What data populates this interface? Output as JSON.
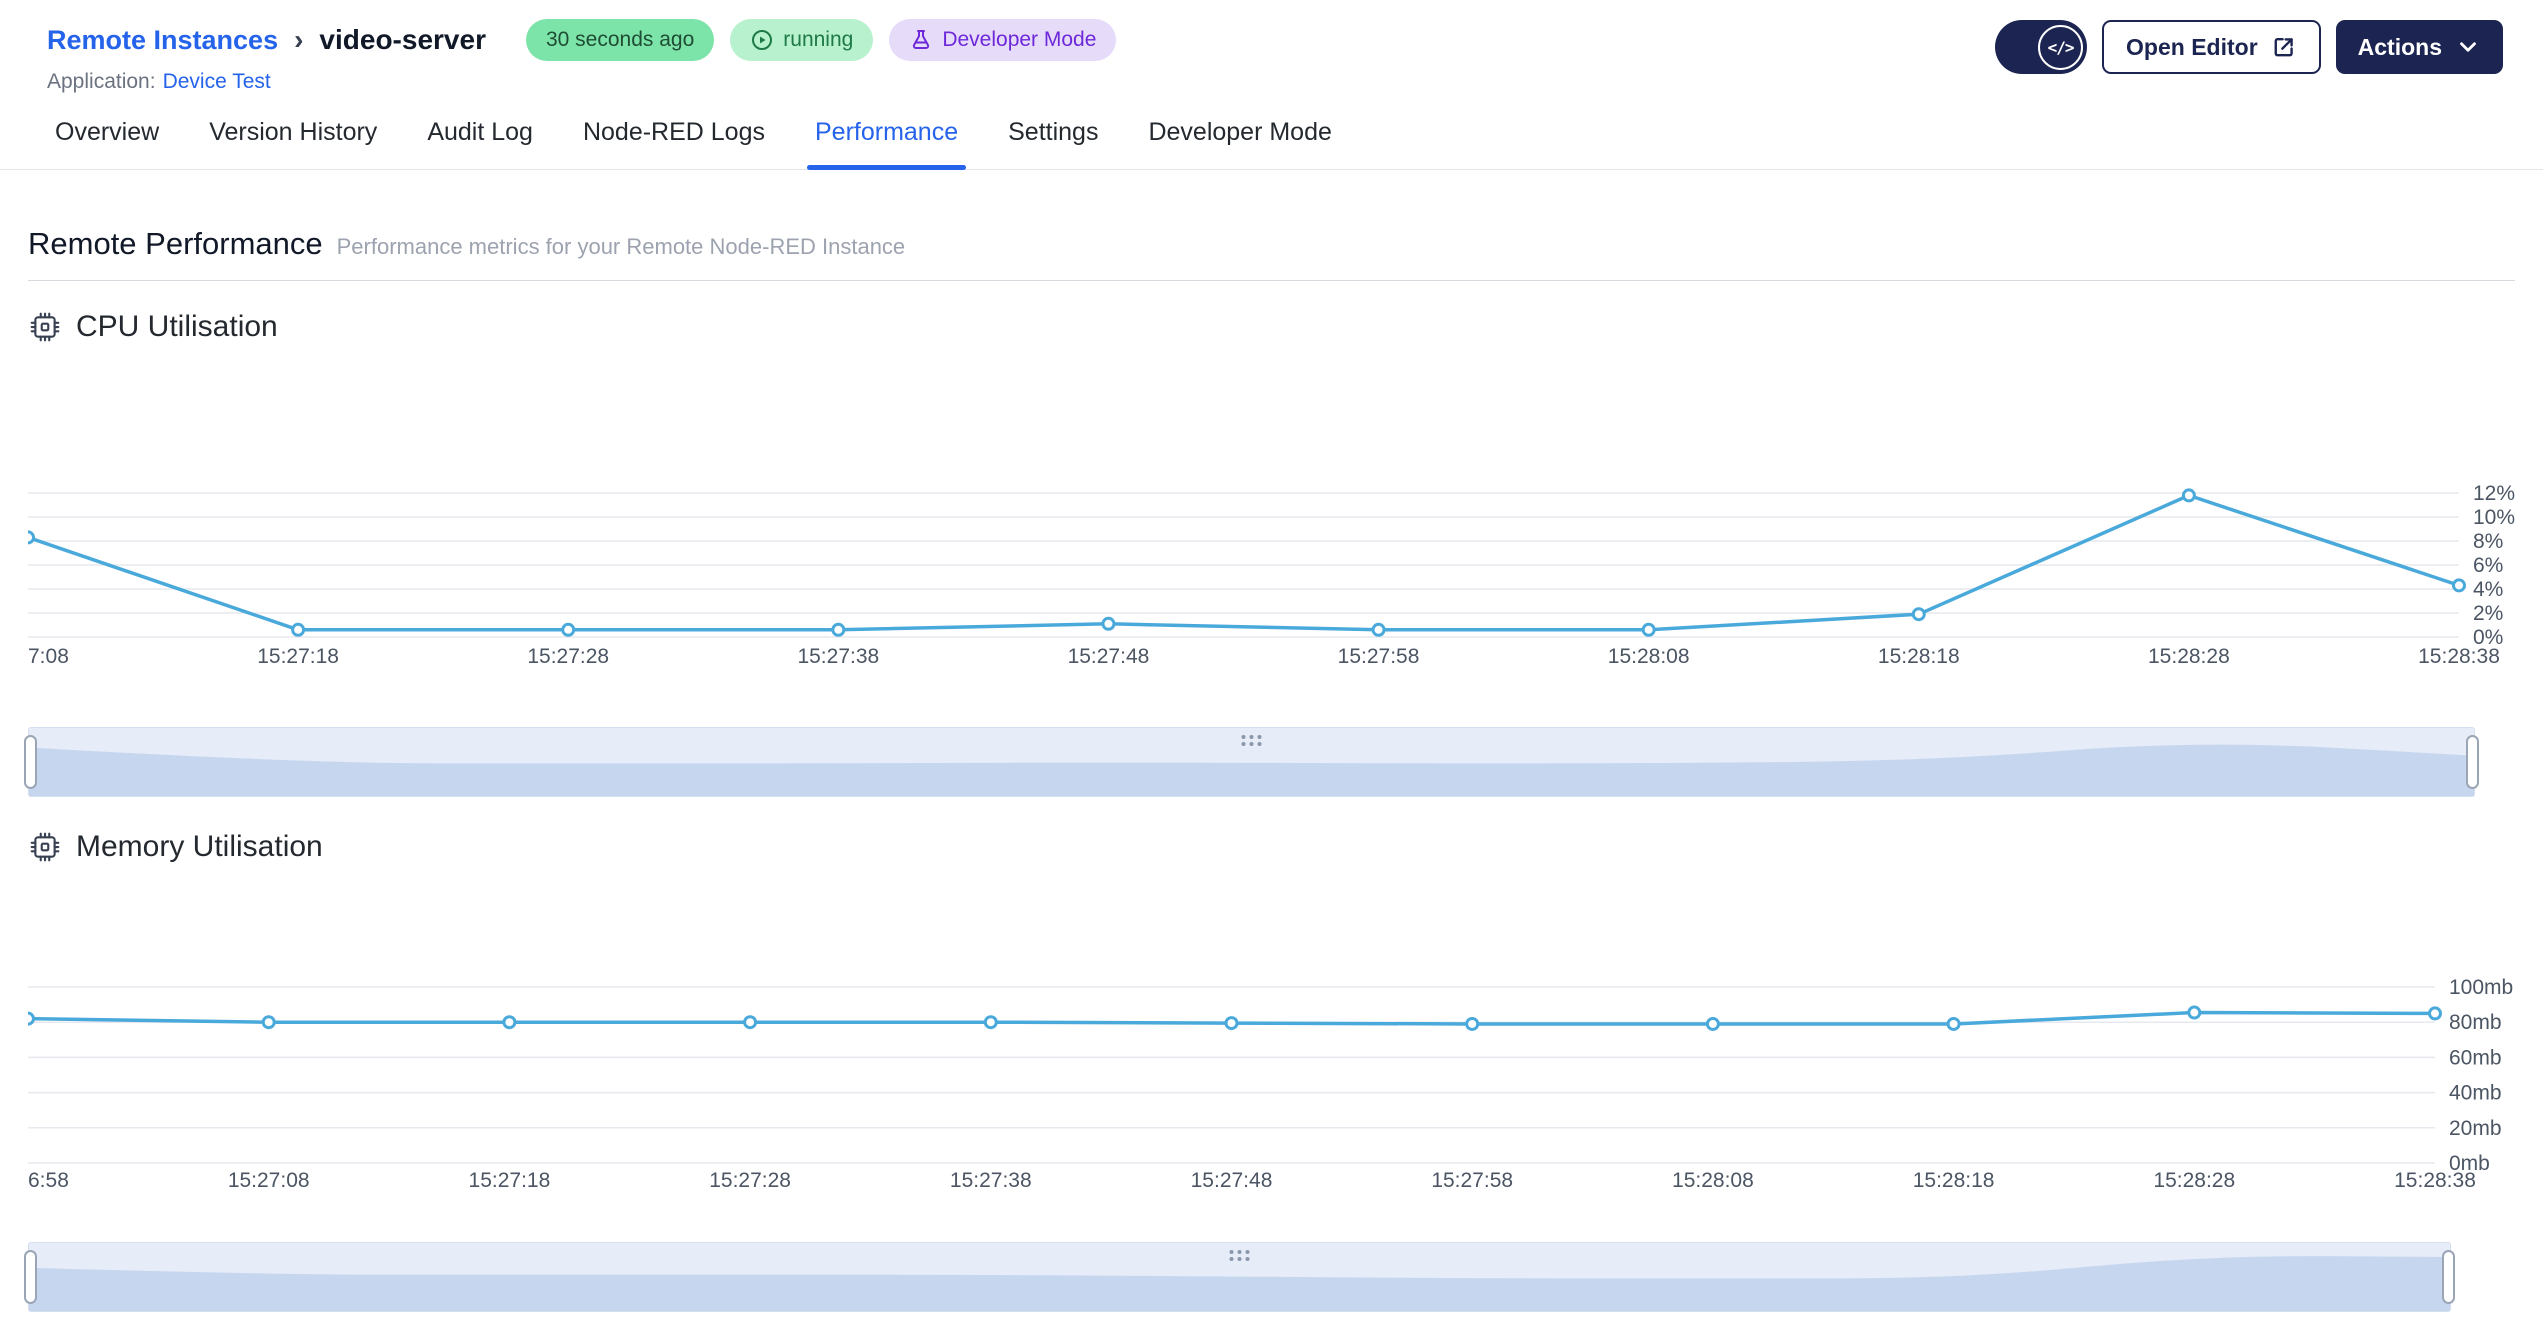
{
  "header": {
    "breadcrumb": {
      "root": "Remote Instances",
      "separator": "›",
      "current": "video-server"
    },
    "badges": {
      "last_seen": "30 seconds ago",
      "status": "running",
      "mode": "Developer Mode"
    },
    "application_label": "Application:",
    "application_name": "Device Test",
    "developer_toggle_icon": "</>",
    "open_editor_label": "Open Editor",
    "actions_label": "Actions"
  },
  "tabs": [
    {
      "label": "Overview",
      "active": false
    },
    {
      "label": "Version History",
      "active": false
    },
    {
      "label": "Audit Log",
      "active": false
    },
    {
      "label": "Node-RED Logs",
      "active": false
    },
    {
      "label": "Performance",
      "active": true
    },
    {
      "label": "Settings",
      "active": false
    },
    {
      "label": "Developer Mode",
      "active": false
    }
  ],
  "page": {
    "title": "Remote Performance",
    "subtitle": "Performance metrics for your Remote Node-RED Instance"
  },
  "icons": {
    "status_badge": "play-circle",
    "mode_badge": "flask",
    "developer_toggle": "code",
    "open_editor": "external-link",
    "actions": "chevron-down",
    "section": "cpu-chip",
    "brush": "grip-dots"
  },
  "chart_data": [
    {
      "type": "line",
      "title": "CPU Utilisation",
      "x": [
        "7:08",
        "15:27:18",
        "15:27:28",
        "15:27:38",
        "15:27:48",
        "15:27:58",
        "15:28:08",
        "15:28:18",
        "15:28:28",
        "15:28:38"
      ],
      "values": [
        8.3,
        0.6,
        0.6,
        0.6,
        1.1,
        0.6,
        0.6,
        1.9,
        11.8,
        4.3
      ],
      "y_ticks": [
        "0%",
        "2%",
        "4%",
        "6%",
        "8%",
        "10%",
        "12%"
      ],
      "ylim": [
        0,
        12
      ],
      "unit": "%",
      "grid": true,
      "legend": "none",
      "line_color": "#4aa9db",
      "has_range_brush": true
    },
    {
      "type": "line",
      "title": "Memory Utilisation",
      "x": [
        "6:58",
        "15:27:08",
        "15:27:18",
        "15:27:28",
        "15:27:38",
        "15:27:48",
        "15:27:58",
        "15:28:08",
        "15:28:18",
        "15:28:28",
        "15:28:38"
      ],
      "values": [
        82,
        80,
        80,
        80,
        80,
        79.5,
        79,
        79,
        79,
        85.5,
        85
      ],
      "y_ticks": [
        "0mb",
        "20mb",
        "40mb",
        "60mb",
        "80mb",
        "100mb"
      ],
      "ylim": [
        0,
        100
      ],
      "unit": "mb",
      "grid": true,
      "legend": "none",
      "line_color": "#4aa9db",
      "has_range_brush": true
    }
  ],
  "colors": {
    "accent": "#2563eb",
    "navy": "#1c2451",
    "chart_line": "#4aa9db",
    "grid": "#e7e9ee",
    "axis_text": "#4b5563",
    "badge_time_bg": "#7ce3a9",
    "badge_time_text": "#1f4d33",
    "badge_status_bg": "#b8f1cd",
    "badge_status_text": "#1d7a46",
    "badge_mode_bg": "#e6dbf9",
    "badge_mode_text": "#6d28d9",
    "brush_bg": "#e6ecf8",
    "brush_fill": "#c7d6ef",
    "subtitle_text": "#9ca3af"
  }
}
